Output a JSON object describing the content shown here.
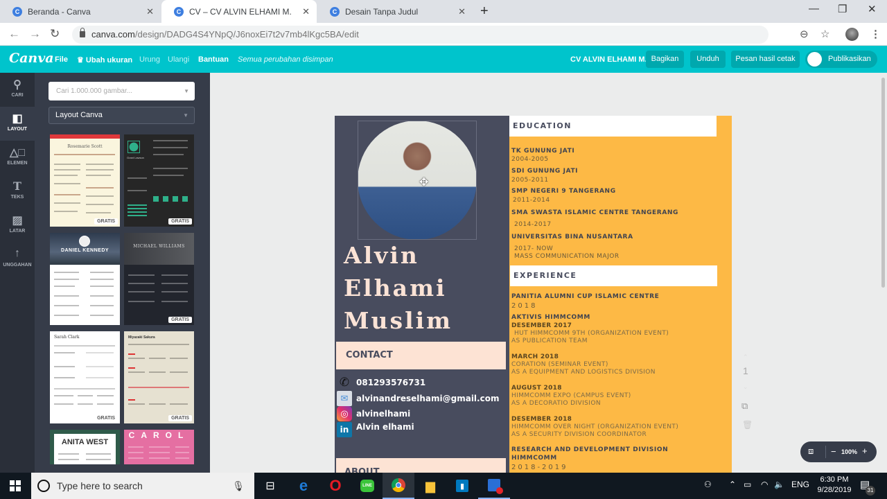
{
  "browser": {
    "tabs": [
      {
        "title": "Beranda - Canva",
        "active": false
      },
      {
        "title": "CV – CV ALVIN ELHAMI M.",
        "active": true
      },
      {
        "title": "Desain Tanpa Judul",
        "active": false
      }
    ],
    "url_domain": "canva.com",
    "url_path": "/design/DADG4S4YNpQ/J6noxEi7t2v7mb4lKgc5BA/edit"
  },
  "topbar": {
    "logo": "Canva",
    "file": "File",
    "resize": "Ubah ukuran",
    "undo": "Urung",
    "redo": "Ulangi",
    "help": "Bantuan",
    "saved_status": "Semua perubahan disimpan",
    "doc_title": "CV ALVIN ELHAMI M.",
    "share": "Bagikan",
    "download": "Unduh",
    "print": "Pesan hasil cetak",
    "publish": "Publikasikan"
  },
  "rail": [
    {
      "label": "CARI",
      "icon": "search-icon"
    },
    {
      "label": "LAYOUT",
      "icon": "layout-icon",
      "active": true
    },
    {
      "label": "ELEMEN",
      "icon": "elements-icon"
    },
    {
      "label": "TEKS",
      "icon": "text-icon"
    },
    {
      "label": "LATAR",
      "icon": "background-icon"
    },
    {
      "label": "UNGGAHAN",
      "icon": "upload-icon"
    }
  ],
  "panel": {
    "search_placeholder": "Cari 1.000.000 gambar...",
    "select_value": "Layout Canva",
    "badge": "GRATIS",
    "templates": [
      {
        "title": "Rosemarie Scott"
      },
      {
        "title": "Grant Lawson"
      },
      {
        "title": "DANIEL KENNEDY"
      },
      {
        "title": "MICHAEL WILLIAMS"
      },
      {
        "title": "Sarah Clark"
      },
      {
        "title": "Miyazaki Sakura"
      },
      {
        "title": "ANITA WEST"
      },
      {
        "title": "CAROL"
      }
    ]
  },
  "cv": {
    "name_lines": [
      "Alvin",
      "Elhami",
      "Muslim"
    ],
    "contact_heading": "CONTACT",
    "phone": "081293576731",
    "email": "alvinandreselhami@gmail.com",
    "instagram": "alvinelhami",
    "linkedin": "Alvin elhami",
    "about_heading": "ABOUT",
    "education_heading": "EDUCATION",
    "education": [
      {
        "school": "TK GUNUNG JATI",
        "years": "2004-2005"
      },
      {
        "school": "SDI GUNUNG JATI",
        "years": "2005-2011"
      },
      {
        "school": "SMP NEGERI 9 TANGERANG",
        "years": "2011-2014"
      },
      {
        "school": "SMA SWASTA ISLAMIC CENTRE TANGERANG",
        "years": "2014-2017"
      },
      {
        "school": "UNIVERSITAS BINA NUSANTARA",
        "years": "2017- NOW",
        "note": "MASS COMMUNICATION MAJOR"
      }
    ],
    "experience_heading": "EXPERIENCE",
    "exp1_title": "PANITIA ALUMNI CUP ISLAMIC CENTRE",
    "exp1_year": "2018",
    "exp2_title": "AKTIVIS HIMMCOMM",
    "exp2_items": [
      {
        "date": "DESEMBER 2017",
        "event": "HUT HIMMCOMM 9TH (ORGANIZATION EVENT)",
        "role": "AS PUBLICATION TEAM"
      },
      {
        "date": "MARCH 2018",
        "event": "CORATION (SEMINAR EVENT)",
        "role": "AS A EQUIPMENT AND LOGISTICS DIVISION"
      },
      {
        "date": "AUGUST 2018",
        "event": "HIMMCOMM EXPO (CAMPUS EVENT)",
        "role": "AS A DECORATIO DIVISION"
      },
      {
        "date": "DESEMBER 2018",
        "event": "HIMMCOMM OVER NIGHT (ORGANIZATION EVENT)",
        "role": "AS A SECURITY DIVISION COORDINATOR"
      }
    ],
    "exp3_title": "RESEARCH AND DEVELOPMENT DIVISION",
    "exp3_title2": "HIMMCOMM",
    "exp3_year": "2018-2019"
  },
  "canvas_tools": {
    "page_number": "1",
    "zoom": "100%"
  },
  "taskbar": {
    "search_placeholder": "Type here to search",
    "lang": "ENG",
    "time": "6:30 PM",
    "date": "9/28/2019",
    "notifications": "31"
  },
  "colors": {
    "canva_teal": "#00c4cc",
    "cv_slate": "#484c5e",
    "cv_orange": "#fdb945",
    "cv_peach": "#fde3d4"
  }
}
